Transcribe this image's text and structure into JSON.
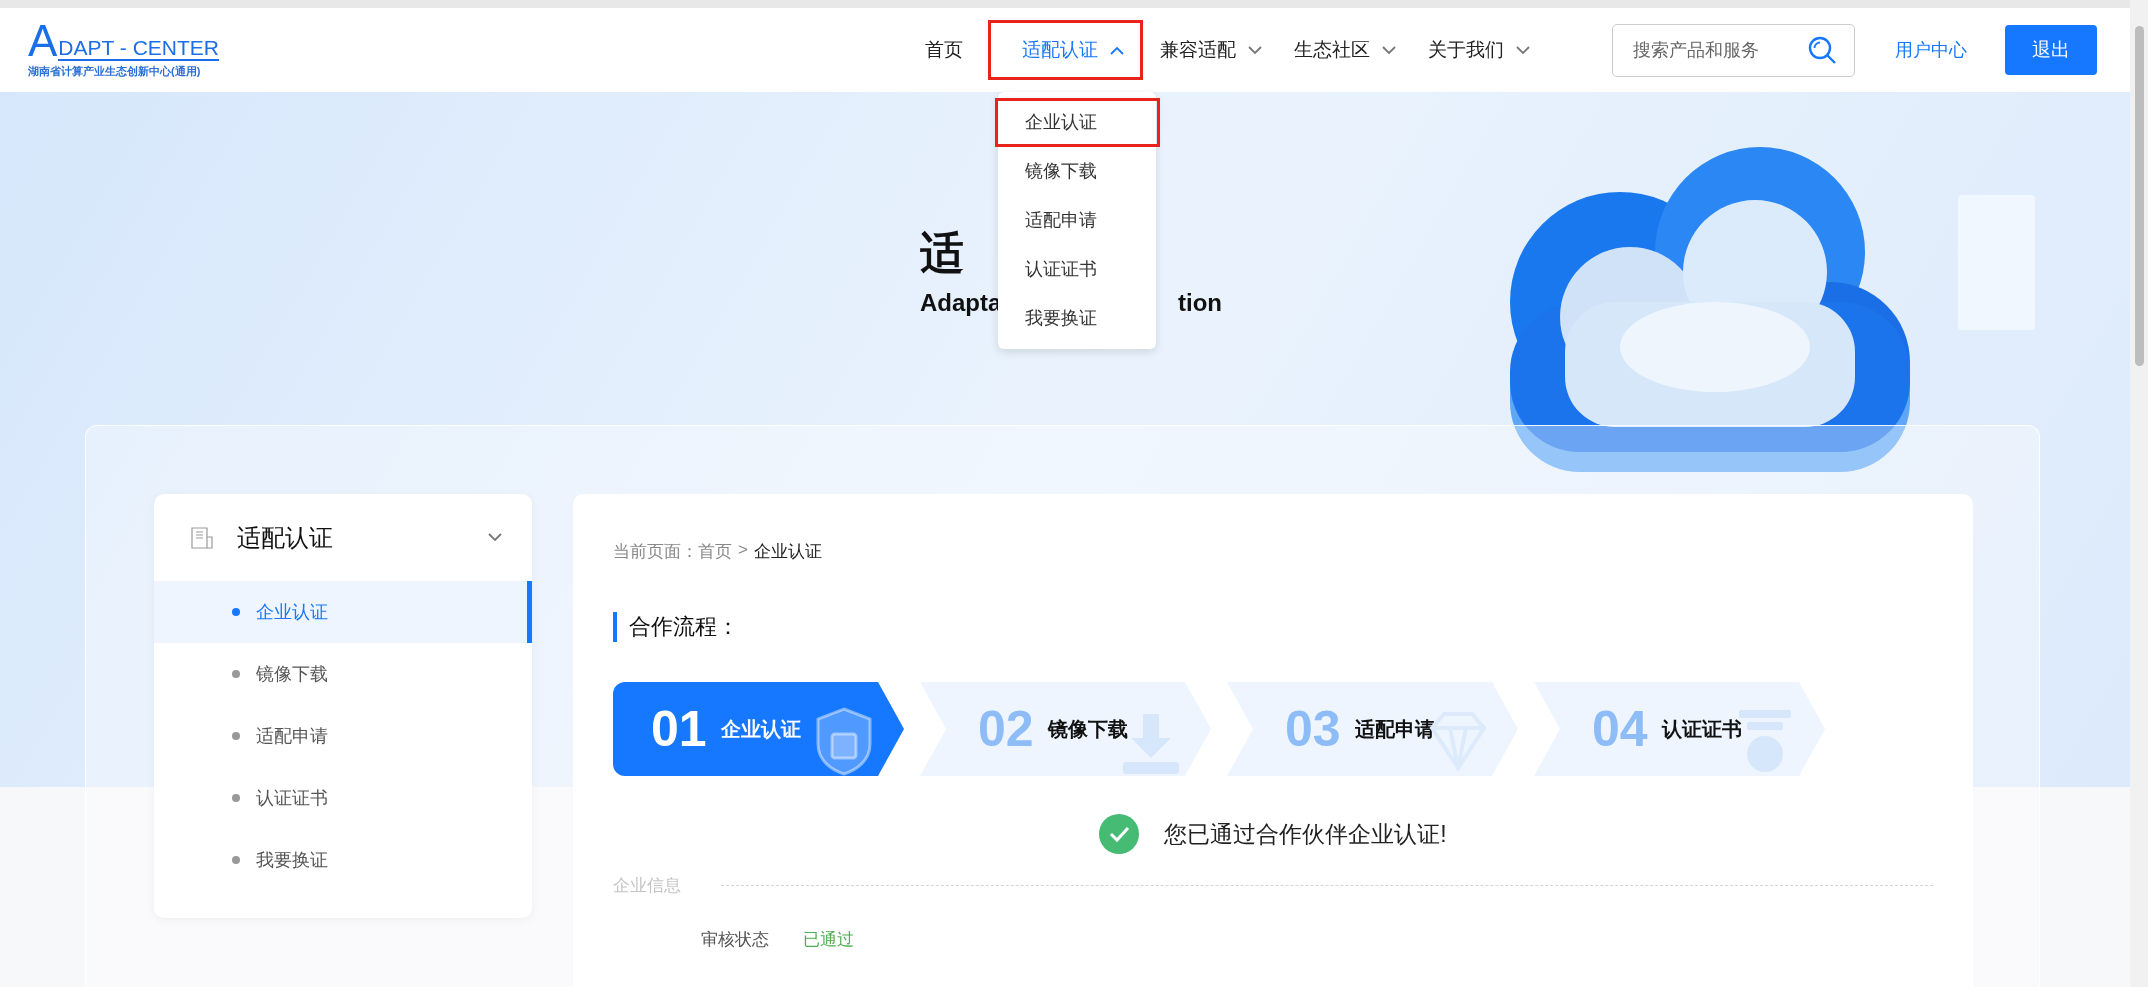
{
  "header": {
    "logo": {
      "letter": "A",
      "name": "DAPT - CENTER",
      "subtitle": "湖南省计算产业生态创新中心(通用)"
    },
    "nav": [
      {
        "label": "首页",
        "kind": "link",
        "selected": false,
        "expanded": false,
        "highlighted": false
      },
      {
        "label": "适配认证",
        "kind": "menu",
        "selected": true,
        "expanded": true,
        "highlighted": true
      },
      {
        "label": "兼容适配",
        "kind": "menu",
        "selected": false,
        "expanded": false,
        "highlighted": false
      },
      {
        "label": "生态社区",
        "kind": "menu",
        "selected": false,
        "expanded": false,
        "highlighted": false
      },
      {
        "label": "关于我们",
        "kind": "menu",
        "selected": false,
        "expanded": false,
        "highlighted": false
      }
    ],
    "dropdown": [
      {
        "label": "企业认证",
        "highlighted": true
      },
      {
        "label": "镜像下载",
        "highlighted": false
      },
      {
        "label": "适配申请",
        "highlighted": false
      },
      {
        "label": "认证证书",
        "highlighted": false
      },
      {
        "label": "我要换证",
        "highlighted": false
      }
    ],
    "search": {
      "placeholder": "搜索产品和服务"
    },
    "user_center": "用户中心",
    "logout": "退出"
  },
  "hero": {
    "title": "适",
    "subtitle_left": "Adapta",
    "subtitle_right": "tion"
  },
  "sidebar": {
    "title": "适配认证",
    "expanded": true,
    "items": [
      {
        "label": "企业认证",
        "selected": true
      },
      {
        "label": "镜像下载",
        "selected": false
      },
      {
        "label": "适配申请",
        "selected": false
      },
      {
        "label": "认证证书",
        "selected": false
      },
      {
        "label": "我要换证",
        "selected": false
      }
    ]
  },
  "content": {
    "breadcrumb": {
      "label": "当前页面：",
      "home": "首页",
      "separator": ">",
      "current": "企业认证"
    },
    "section_title": "合作流程：",
    "steps": [
      {
        "number": "01",
        "label": "企业认证",
        "selected": true,
        "kind": "shield"
      },
      {
        "number": "02",
        "label": "镜像下载",
        "selected": false,
        "kind": "download"
      },
      {
        "number": "03",
        "label": "适配申请",
        "selected": false,
        "kind": "gem"
      },
      {
        "number": "04",
        "label": "认证证书",
        "selected": false,
        "kind": "medal"
      }
    ],
    "success_message": "您已通过合作伙伴企业认证!",
    "info_section": "企业信息",
    "fields": [
      {
        "label": "审核状态",
        "value": "已通过"
      }
    ]
  }
}
